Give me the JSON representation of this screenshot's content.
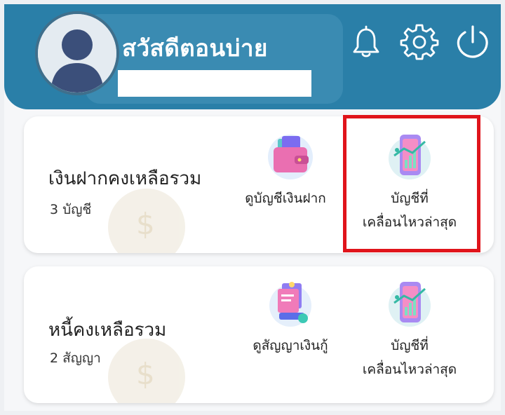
{
  "header": {
    "greeting": "สวัสดีตอนบ่าย",
    "name_value": "",
    "icons": [
      "bell-icon",
      "gear-icon",
      "power-icon"
    ],
    "bg_color": "#2a7fa8"
  },
  "deposit_card": {
    "title": "เงินฝากคงเหลือรวม",
    "subtitle": "3 บัญชี",
    "actions": [
      {
        "label": "ดูบัญชีเงินฝาก",
        "icon": "wallet-icon"
      },
      {
        "label": "บัญชีที่\nเคลื่อนไหวล่าสุด",
        "icon": "phone-chart-icon"
      }
    ]
  },
  "loan_card": {
    "title": "หนี้คงเหลือรวม",
    "subtitle": "2 สัญญา",
    "actions": [
      {
        "label": "ดูสัญญาเงินกู้",
        "icon": "loan-contract-icon"
      },
      {
        "label": "บัญชีที่\nเคลื่อนไหวล่าสุด",
        "icon": "phone-chart-icon"
      }
    ]
  },
  "highlight_color": "#e0141b"
}
